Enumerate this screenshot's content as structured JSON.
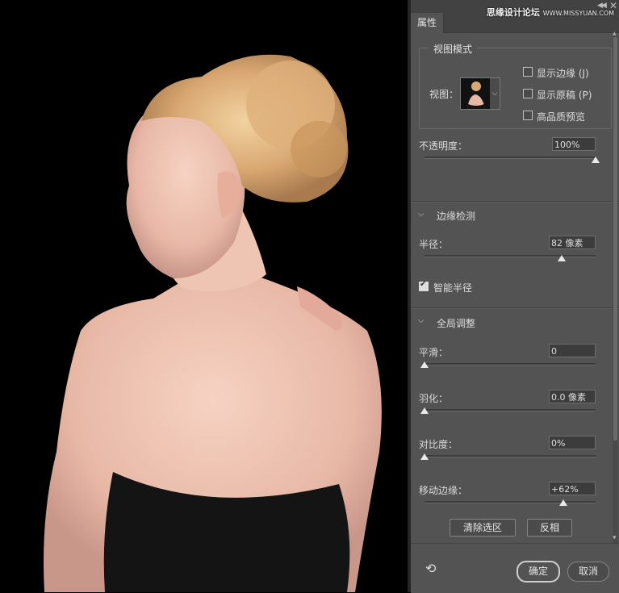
{
  "watermark": {
    "text": "思缘设计论坛",
    "site": "WWW.MISSYUAN.COM"
  },
  "panel": {
    "tab": "属性",
    "view_mode": {
      "title": "视图模式",
      "view_label": "视图：",
      "show_edges": {
        "label": "显示边缘 (J)",
        "checked": false
      },
      "show_original": {
        "label": "显示原稿 (P)",
        "checked": false
      },
      "high_quality": {
        "label": "高品质预览",
        "checked": false
      }
    },
    "opacity": {
      "label": "不透明度：",
      "value": "100%",
      "fraction": 1.0
    },
    "edge_detection": {
      "title": "边缘检测",
      "radius": {
        "label": "半径：",
        "value": "82 像素",
        "fraction": 0.8
      },
      "smart_radius": {
        "label": "智能半径",
        "checked": true
      }
    },
    "global_refine": {
      "title": "全局调整",
      "smooth": {
        "label": "平滑：",
        "value": "0",
        "fraction": 0.0
      },
      "feather": {
        "label": "羽化：",
        "value": "0.0 像素",
        "fraction": 0.0
      },
      "contrast": {
        "label": "对比度：",
        "value": "0%",
        "fraction": 0.0
      },
      "shift_edge": {
        "label": "移动边缘：",
        "value": "+62%",
        "fraction": 0.81
      }
    },
    "buttons": {
      "clear_selection": "清除选区",
      "invert": "反相",
      "ok": "确定",
      "cancel": "取消"
    }
  },
  "icons": {
    "reset": "reset-icon",
    "collapse": "double-chevron-icon",
    "close": "close-icon",
    "section": "chevron-down-icon"
  },
  "colors": {
    "panel_bg": "#535353",
    "canvas_bg": "#000000"
  }
}
